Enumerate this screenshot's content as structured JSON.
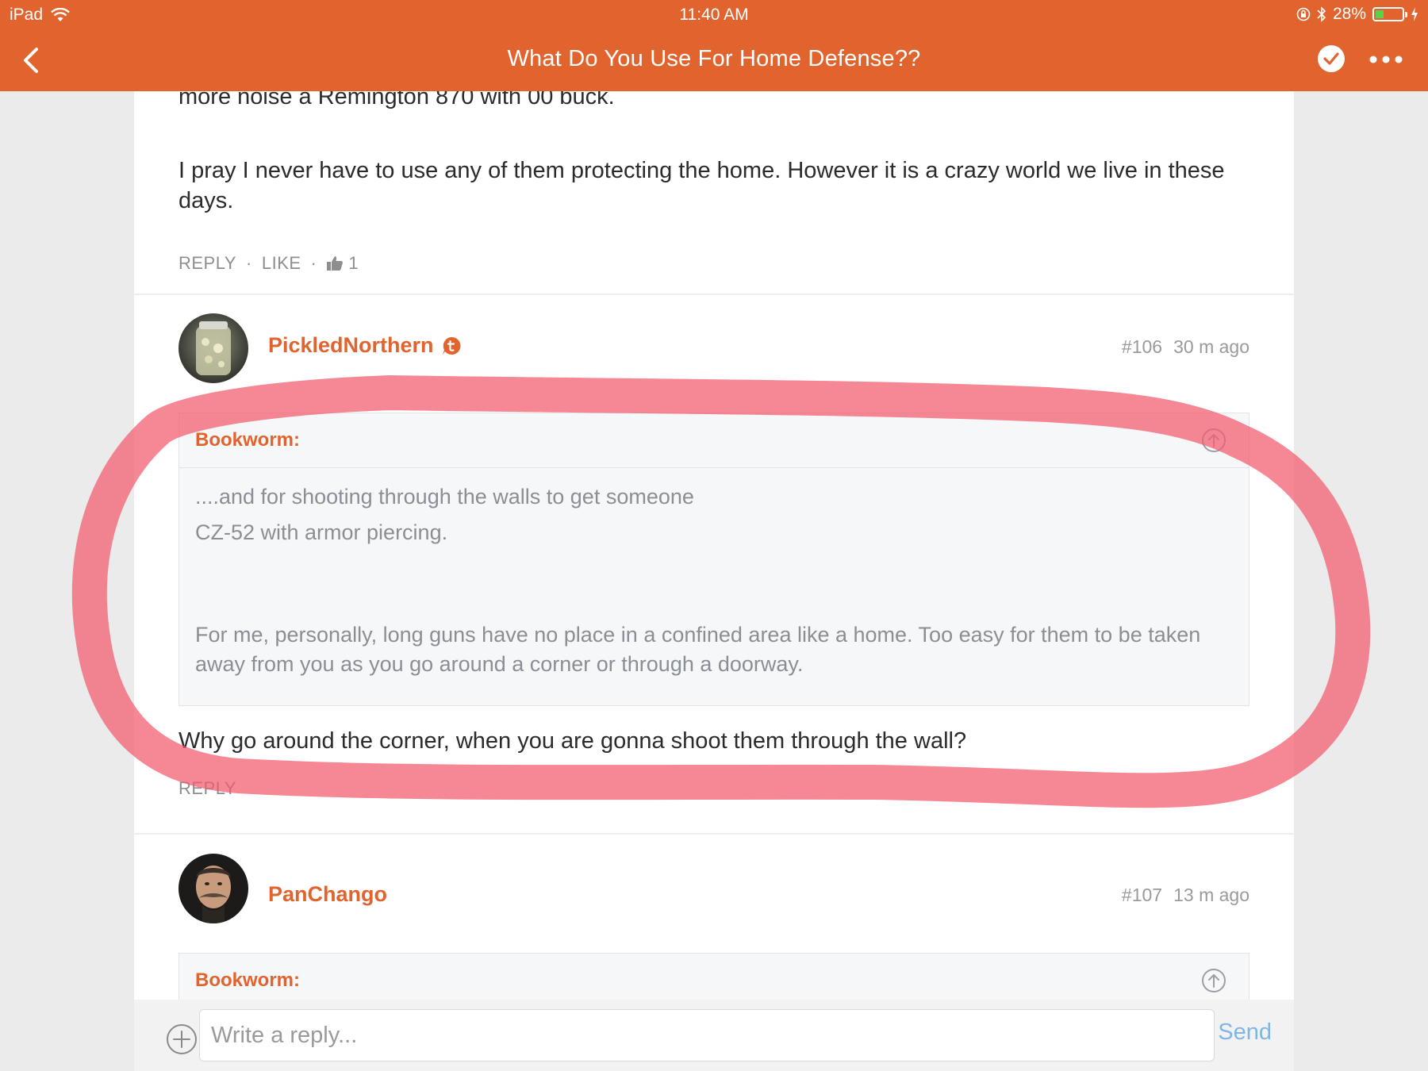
{
  "status_bar": {
    "device": "iPad",
    "time": "11:40 AM",
    "battery": "28%",
    "battery_level": 0.28
  },
  "nav": {
    "title": "What Do You Use For Home Defense??"
  },
  "previous_post": {
    "partial_line": "more noise a Remington 870 with 00 buck.",
    "paragraph": "I pray I never have to use any of them protecting the home. However it is a crazy world we live in these days.",
    "reply_label": "REPLY",
    "like_label": "LIKE",
    "like_count": "1"
  },
  "post_106": {
    "author": "PickledNorthern",
    "number": "#106",
    "time": "30 m ago",
    "quote": {
      "author": "Bookworm:",
      "line1": "....and for shooting through the walls to get someone",
      "line2": "CZ-52 with armor piercing.",
      "paragraph": "For me, personally, long guns have no place in a confined area like a home. Too easy for them to be taken away from you as you go around a corner or through a doorway."
    },
    "body": "Why go around the corner, when you are gonna shoot them through the wall?",
    "reply_label": "REPLY"
  },
  "post_107": {
    "author": "PanChango",
    "number": "#107",
    "time": "13 m ago",
    "quote": {
      "author": "Bookworm:"
    }
  },
  "composer": {
    "placeholder": "Write a reply...",
    "send_label": "Send"
  },
  "colors": {
    "brand": "#e1642f",
    "annotation": "#f35a6e",
    "send": "#7fb6e6"
  }
}
